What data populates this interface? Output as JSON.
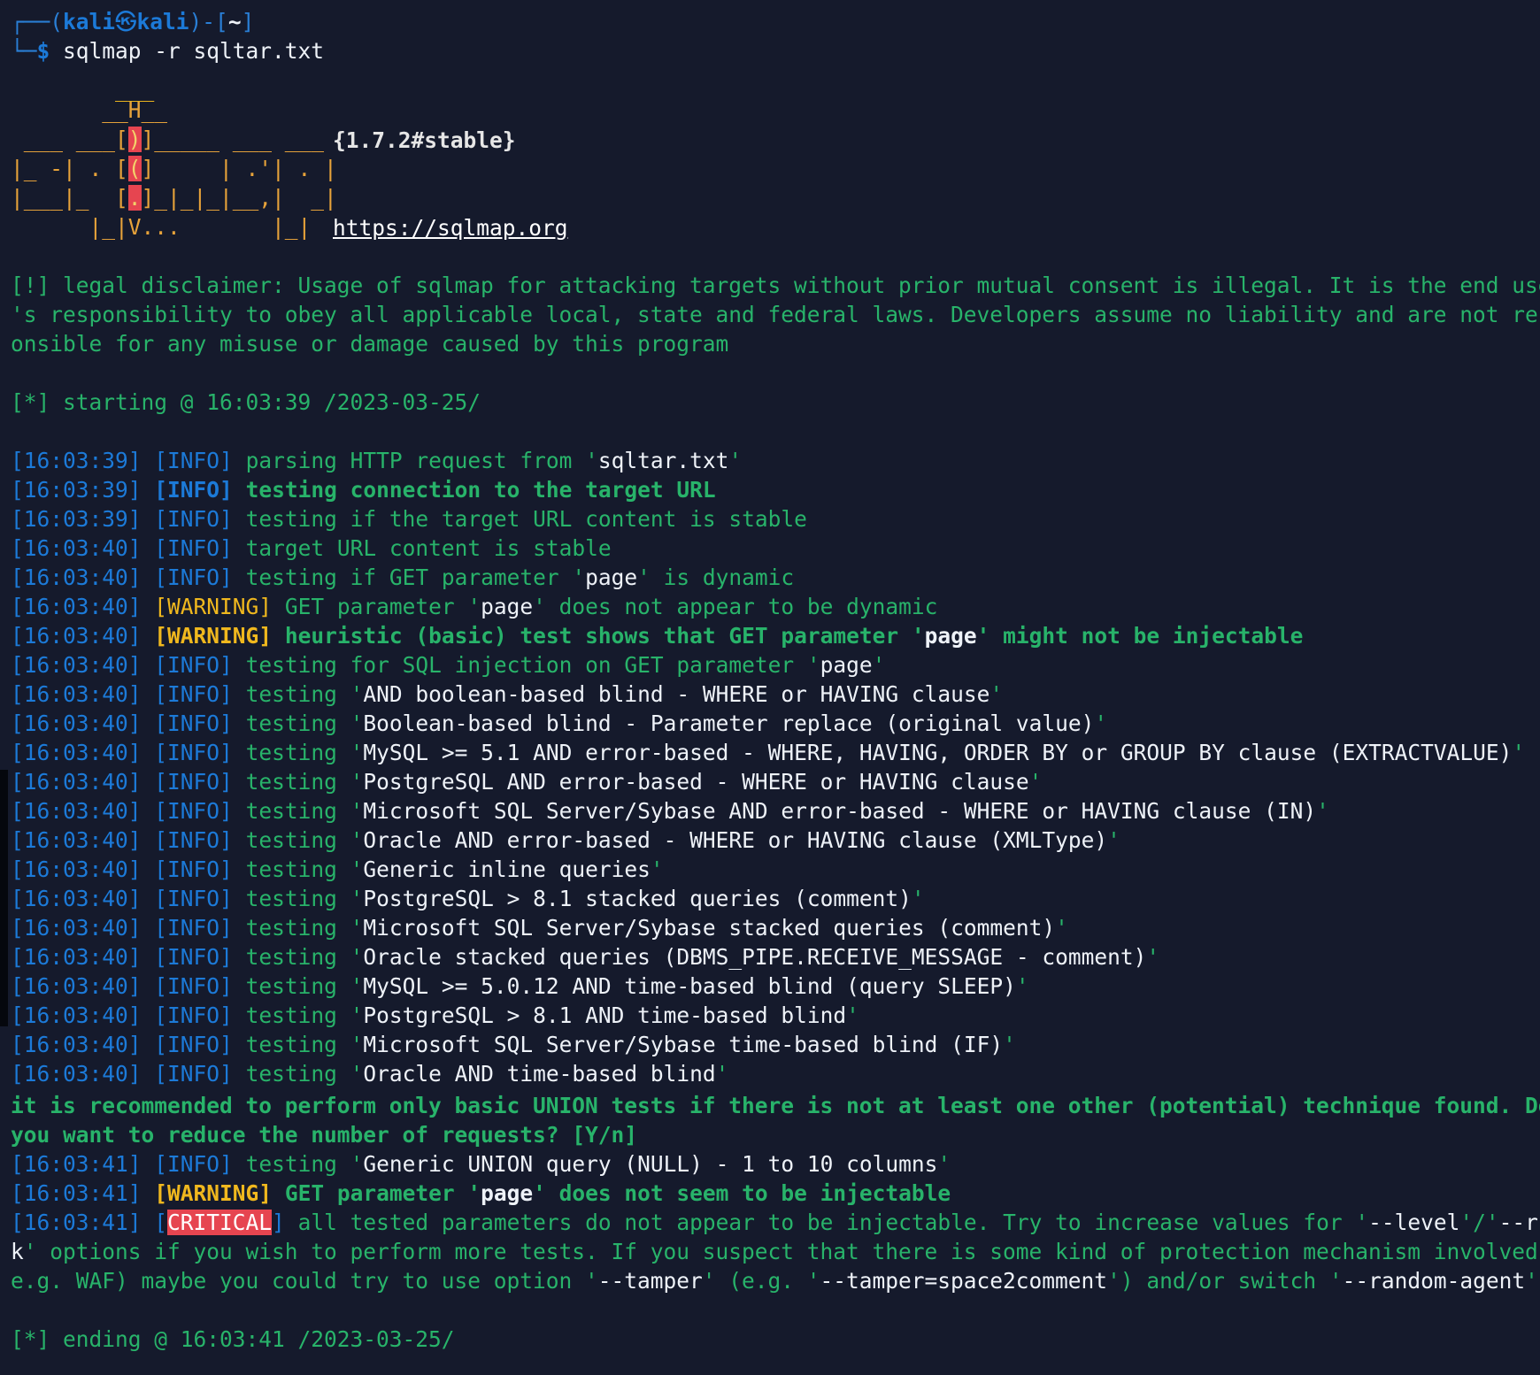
{
  "prompt": {
    "frame_left": "┌──(",
    "user": "kali",
    "sep_icon": "㉿",
    "host": "kali",
    "frame_mid": ")-[",
    "path": "~",
    "frame_right": "]",
    "frame_bottom": "└─",
    "dollar": "$",
    "command": " sqlmap -r sqltar.txt"
  },
  "banner": {
    "art": [
      "        ___",
      "       __H__",
      " ___ ___[)]_____ ___ ___",
      "|_ -| . [(]     | .'| . |",
      "|___|_  [.]_|_|_|__,|  _|",
      "      |_|V...       |_|"
    ],
    "version": "{1.7.2#stable}",
    "url": "https://sqlmap.org"
  },
  "disclaimer": [
    "[!] legal disclaimer: Usage of sqlmap for attacking targets without prior mutual consent is illegal. It is the end user",
    "'s responsibility to obey all applicable local, state and federal laws. Developers assume no liability and are not resp",
    "onsible for any misuse or damage caused by this program"
  ],
  "starting": "[*] starting @ 16:03:39 /2023-03-25/",
  "log": [
    {
      "time": "[16:03:39]",
      "level": "INFO",
      "parts": [
        {
          "t": "parsing HTTP request from ",
          "c": "g"
        },
        {
          "t": "'",
          "c": "g"
        },
        {
          "t": "sqltar.txt",
          "c": "w"
        },
        {
          "t": "'",
          "c": "g"
        }
      ]
    },
    {
      "time": "[16:03:39]",
      "level": "INFO",
      "bold": true,
      "parts": [
        {
          "t": "testing connection to the target URL",
          "c": "g"
        }
      ]
    },
    {
      "time": "[16:03:39]",
      "level": "INFO",
      "parts": [
        {
          "t": "testing if the target URL content is stable",
          "c": "g"
        }
      ]
    },
    {
      "time": "[16:03:40]",
      "level": "INFO",
      "parts": [
        {
          "t": "target URL content is stable",
          "c": "g"
        }
      ]
    },
    {
      "time": "[16:03:40]",
      "level": "INFO",
      "parts": [
        {
          "t": "testing if GET parameter '",
          "c": "g"
        },
        {
          "t": "page",
          "c": "w"
        },
        {
          "t": "' is dynamic",
          "c": "g"
        }
      ]
    },
    {
      "time": "[16:03:40]",
      "level": "WARNING",
      "parts": [
        {
          "t": "GET parameter '",
          "c": "g"
        },
        {
          "t": "page",
          "c": "w"
        },
        {
          "t": "' does not appear to be dynamic",
          "c": "g"
        }
      ]
    },
    {
      "time": "[16:03:40]",
      "level": "WARNING",
      "bold": true,
      "parts": [
        {
          "t": "heuristic (basic) test shows that GET parameter '",
          "c": "g"
        },
        {
          "t": "page",
          "c": "w"
        },
        {
          "t": "' might not be injectable",
          "c": "g"
        }
      ]
    },
    {
      "time": "[16:03:40]",
      "level": "INFO",
      "parts": [
        {
          "t": "testing for SQL injection on GET parameter '",
          "c": "g"
        },
        {
          "t": "page",
          "c": "w"
        },
        {
          "t": "'",
          "c": "g"
        }
      ]
    },
    {
      "time": "[16:03:40]",
      "level": "INFO",
      "parts": [
        {
          "t": "testing '",
          "c": "g"
        },
        {
          "t": "AND boolean-based blind - WHERE or HAVING clause",
          "c": "w"
        },
        {
          "t": "'",
          "c": "g"
        }
      ]
    },
    {
      "time": "[16:03:40]",
      "level": "INFO",
      "parts": [
        {
          "t": "testing '",
          "c": "g"
        },
        {
          "t": "Boolean-based blind - Parameter replace (original value)",
          "c": "w"
        },
        {
          "t": "'",
          "c": "g"
        }
      ]
    },
    {
      "time": "[16:03:40]",
      "level": "INFO",
      "parts": [
        {
          "t": "testing '",
          "c": "g"
        },
        {
          "t": "MySQL >= 5.1 AND error-based - WHERE, HAVING, ORDER BY or GROUP BY clause (EXTRACTVALUE)",
          "c": "w"
        },
        {
          "t": "'",
          "c": "g"
        }
      ]
    },
    {
      "time": "[16:03:40]",
      "level": "INFO",
      "parts": [
        {
          "t": "testing '",
          "c": "g"
        },
        {
          "t": "PostgreSQL AND error-based - WHERE or HAVING clause",
          "c": "w"
        },
        {
          "t": "'",
          "c": "g"
        }
      ]
    },
    {
      "time": "[16:03:40]",
      "level": "INFO",
      "parts": [
        {
          "t": "testing '",
          "c": "g"
        },
        {
          "t": "Microsoft SQL Server/Sybase AND error-based - WHERE or HAVING clause (IN)",
          "c": "w"
        },
        {
          "t": "'",
          "c": "g"
        }
      ]
    },
    {
      "time": "[16:03:40]",
      "level": "INFO",
      "parts": [
        {
          "t": "testing '",
          "c": "g"
        },
        {
          "t": "Oracle AND error-based - WHERE or HAVING clause (XMLType)",
          "c": "w"
        },
        {
          "t": "'",
          "c": "g"
        }
      ]
    },
    {
      "time": "[16:03:40]",
      "level": "INFO",
      "parts": [
        {
          "t": "testing '",
          "c": "g"
        },
        {
          "t": "Generic inline queries",
          "c": "w"
        },
        {
          "t": "'",
          "c": "g"
        }
      ]
    },
    {
      "time": "[16:03:40]",
      "level": "INFO",
      "parts": [
        {
          "t": "testing '",
          "c": "g"
        },
        {
          "t": "PostgreSQL > 8.1 stacked queries (comment)",
          "c": "w"
        },
        {
          "t": "'",
          "c": "g"
        }
      ]
    },
    {
      "time": "[16:03:40]",
      "level": "INFO",
      "parts": [
        {
          "t": "testing '",
          "c": "g"
        },
        {
          "t": "Microsoft SQL Server/Sybase stacked queries (comment)",
          "c": "w"
        },
        {
          "t": "'",
          "c": "g"
        }
      ]
    },
    {
      "time": "[16:03:40]",
      "level": "INFO",
      "parts": [
        {
          "t": "testing '",
          "c": "g"
        },
        {
          "t": "Oracle stacked queries (DBMS_PIPE.RECEIVE_MESSAGE - comment)",
          "c": "w"
        },
        {
          "t": "'",
          "c": "g"
        }
      ]
    },
    {
      "time": "[16:03:40]",
      "level": "INFO",
      "parts": [
        {
          "t": "testing '",
          "c": "g"
        },
        {
          "t": "MySQL >= 5.0.12 AND time-based blind (query SLEEP)",
          "c": "w"
        },
        {
          "t": "'",
          "c": "g"
        }
      ]
    },
    {
      "time": "[16:03:40]",
      "level": "INFO",
      "parts": [
        {
          "t": "testing '",
          "c": "g"
        },
        {
          "t": "PostgreSQL > 8.1 AND time-based blind",
          "c": "w"
        },
        {
          "t": "'",
          "c": "g"
        }
      ]
    },
    {
      "time": "[16:03:40]",
      "level": "INFO",
      "parts": [
        {
          "t": "testing '",
          "c": "g"
        },
        {
          "t": "Microsoft SQL Server/Sybase time-based blind (IF)",
          "c": "w"
        },
        {
          "t": "'",
          "c": "g"
        }
      ]
    },
    {
      "time": "[16:03:40]",
      "level": "INFO",
      "parts": [
        {
          "t": "testing '",
          "c": "g"
        },
        {
          "t": "Oracle AND time-based blind",
          "c": "w"
        },
        {
          "t": "'",
          "c": "g"
        }
      ]
    }
  ],
  "question": [
    "it is recommended to perform only basic UNION tests if there is not at least one other (potential) technique found. Do",
    "you want to reduce the number of requests? [Y/n]"
  ],
  "log2": [
    {
      "time": "[16:03:41]",
      "level": "INFO",
      "parts": [
        {
          "t": "testing '",
          "c": "g"
        },
        {
          "t": "Generic UNION query (NULL) - 1 to 10 columns",
          "c": "w"
        },
        {
          "t": "'",
          "c": "g"
        }
      ]
    },
    {
      "time": "[16:03:41]",
      "level": "WARNING",
      "bold": true,
      "parts": [
        {
          "t": "GET parameter '",
          "c": "g"
        },
        {
          "t": "page",
          "c": "w"
        },
        {
          "t": "' does not seem to be injectable",
          "c": "g"
        }
      ]
    }
  ],
  "critical": {
    "time": "[16:03:41]",
    "level": "CRITICAL",
    "line1": [
      {
        "t": " all tested parameters do not appear to be injectable. Try to increase values for '",
        "c": "g"
      },
      {
        "t": "--level",
        "c": "w"
      },
      {
        "t": "'/'",
        "c": "g"
      },
      {
        "t": "--ris",
        "c": "w"
      }
    ],
    "line2": [
      {
        "t": "k",
        "c": "w"
      },
      {
        "t": "' options if you wish to perform more tests. If you suspect that there is some kind of protection mechanism involved (",
        "c": "g"
      }
    ],
    "line3": [
      {
        "t": "e.g. WAF) maybe you could try to use option '",
        "c": "g"
      },
      {
        "t": "--tamper",
        "c": "w"
      },
      {
        "t": "' (e.g. '",
        "c": "g"
      },
      {
        "t": "--tamper=space2comment",
        "c": "w"
      },
      {
        "t": "') and/or switch '",
        "c": "g"
      },
      {
        "t": "--random-agent",
        "c": "w"
      },
      {
        "t": "'",
        "c": "g"
      }
    ]
  },
  "ending": "[*] ending @ 16:03:41 /2023-03-25/",
  "colors": {
    "background": "#151a2c",
    "green": "#28b36a",
    "blue": "#1c7ad8",
    "yellow": "#f0b81e",
    "critical": "#e64550"
  }
}
